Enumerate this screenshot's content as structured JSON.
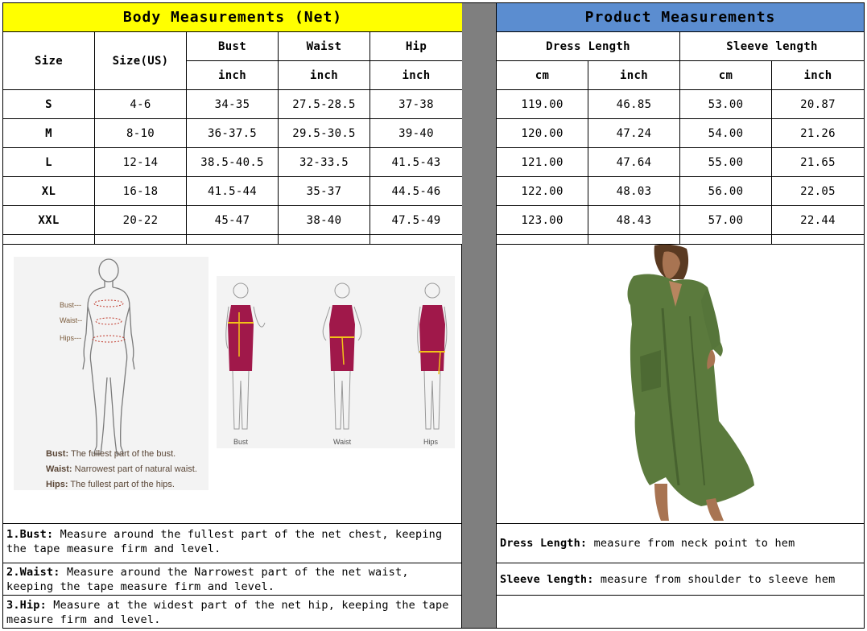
{
  "left_title": "Body Measurements (Net)",
  "right_title": "Product Measurements",
  "colors": {
    "yellow": "#ffff00",
    "blue": "#5b8dd0",
    "gray": "#7f7f7f",
    "dress": "#5b7a3d",
    "sleeveless": "#a0184a"
  },
  "body_headers": {
    "size": "Size",
    "size_us": "Size(US)",
    "bust": "Bust",
    "waist": "Waist",
    "hip": "Hip",
    "unit": "inch"
  },
  "product_headers": {
    "dress_length": "Dress Length",
    "sleeve_length": "Sleeve length",
    "cm": "cm",
    "inch": "inch"
  },
  "rows": [
    {
      "size": "S",
      "us": "4-6",
      "bust": "34-35",
      "waist": "27.5-28.5",
      "hip": "37-38",
      "dl_cm": "119.00",
      "dl_in": "46.85",
      "sl_cm": "53.00",
      "sl_in": "20.87"
    },
    {
      "size": "M",
      "us": "8-10",
      "bust": "36-37.5",
      "waist": "29.5-30.5",
      "hip": "39-40",
      "dl_cm": "120.00",
      "dl_in": "47.24",
      "sl_cm": "54.00",
      "sl_in": "21.26"
    },
    {
      "size": "L",
      "us": "12-14",
      "bust": "38.5-40.5",
      "waist": "32-33.5",
      "hip": "41.5-43",
      "dl_cm": "121.00",
      "dl_in": "47.64",
      "sl_cm": "55.00",
      "sl_in": "21.65"
    },
    {
      "size": "XL",
      "us": "16-18",
      "bust": "41.5-44",
      "waist": "35-37",
      "hip": "44.5-46",
      "dl_cm": "122.00",
      "dl_in": "48.03",
      "sl_cm": "56.00",
      "sl_in": "22.05"
    },
    {
      "size": "XXL",
      "us": "20-22",
      "bust": "45-47",
      "waist": "38-40",
      "hip": "47.5-49",
      "dl_cm": "123.00",
      "dl_in": "48.43",
      "sl_cm": "57.00",
      "sl_in": "22.44"
    }
  ],
  "figure": {
    "mark_bust": "Bust---",
    "mark_waist": "Waist--",
    "mark_hips": "Hips---",
    "cap_bust_label": "Bust:",
    "cap_bust_text": "The fullest part of the bust.",
    "cap_waist_label": "Waist:",
    "cap_waist_text": "Narrowest part of natural waist.",
    "cap_hips_label": "Hips:",
    "cap_hips_text": "The fullest part of the hips.",
    "fig_bust": "Bust",
    "fig_waist": "Waist",
    "fig_hips": "Hips"
  },
  "notes_left": [
    {
      "label": "1.Bust:",
      "text": " Measure around the fullest part of the net chest, keeping the tape  measure firm and level."
    },
    {
      "label": "2.Waist:",
      "text": " Measure around the Narrowest part of the net waist, keeping the tape  measure firm and level."
    },
    {
      "label": "3.Hip:",
      "text": " Measure at the widest part of the net hip, keeping the tape measure firm and level."
    }
  ],
  "notes_right": [
    {
      "label": "Dress Length:",
      "text": " measure from neck point to hem"
    },
    {
      "label": "Sleeve length:",
      "text": " measure from shoulder to sleeve hem"
    }
  ]
}
